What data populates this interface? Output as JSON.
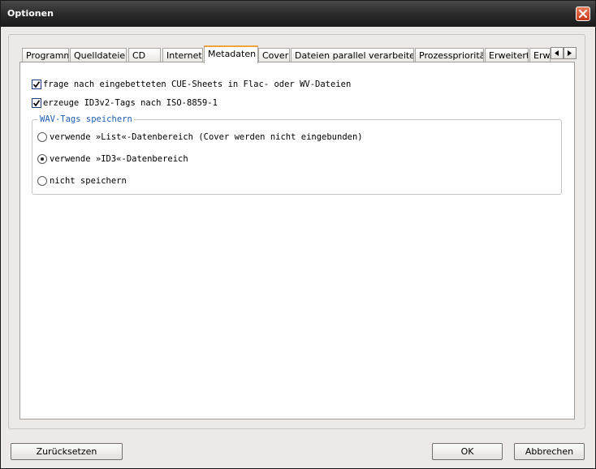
{
  "window": {
    "title": "Optionen"
  },
  "tabs": [
    {
      "label": "Programm"
    },
    {
      "label": "Quelldateien"
    },
    {
      "label": "CD"
    },
    {
      "label": "Internet"
    },
    {
      "label": "Metadaten"
    },
    {
      "label": "Cover"
    },
    {
      "label": "Dateien parallel verarbeiten"
    },
    {
      "label": "Prozesspriorität"
    },
    {
      "label": "Erweitert"
    },
    {
      "label": "Erw"
    }
  ],
  "active_tab": "Metadaten",
  "metadata": {
    "cue_sheets_checkbox": {
      "label": "frage nach eingebetteten CUE-Sheets in Flac- oder WV-Dateien",
      "checked": true
    },
    "id3v2_checkbox": {
      "label": "erzeuge ID3v2-Tags nach ISO-8859-1",
      "checked": true
    },
    "wav_group": {
      "title": "WAV-Tags speichern",
      "options": [
        {
          "label": "verwende »List«-Datenbereich (Cover werden nicht eingebunden)",
          "selected": false
        },
        {
          "label": "verwende »ID3«-Datenbereich",
          "selected": true
        },
        {
          "label": "nicht speichern",
          "selected": false
        }
      ]
    }
  },
  "buttons": {
    "reset": "Zurücksetzen",
    "ok": "OK",
    "cancel": "Abbrechen"
  }
}
